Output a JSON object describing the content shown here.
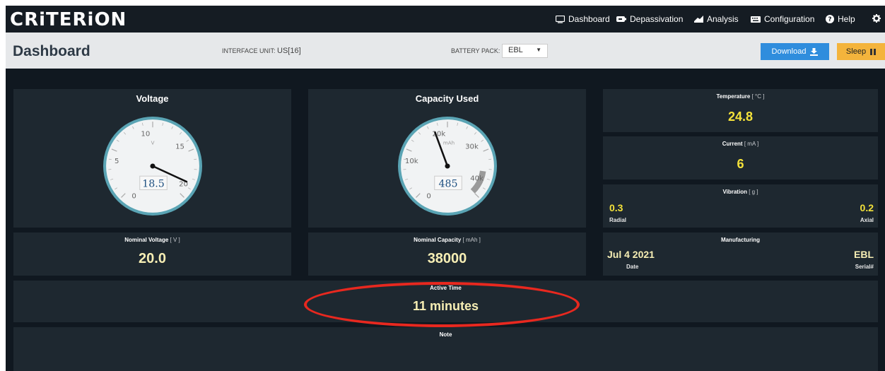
{
  "app": {
    "logo": "CRiTERiON"
  },
  "nav": [
    {
      "label": "Dashboard",
      "icon": "monitor-icon"
    },
    {
      "label": "Depassivation",
      "icon": "battery-icon"
    },
    {
      "label": "Analysis",
      "icon": "chart-icon"
    },
    {
      "label": "Configuration",
      "icon": "keyboard-icon"
    },
    {
      "label": "Help",
      "icon": "question-circle-icon"
    },
    {
      "icon": "gear-icon"
    }
  ],
  "header": {
    "title": "Dashboard",
    "interface_label": "INTERFACE UNIT:",
    "interface_value": "US[16]",
    "battery_pack_label": "BATTERY PACK:",
    "battery_pack_value": "EBL",
    "download_label": "Download",
    "sleep_label": "Sleep"
  },
  "voltage": {
    "title": "Voltage",
    "unit": "V",
    "ticks": [
      "0",
      "5",
      "10",
      "15",
      "20"
    ],
    "max": 20,
    "value": 18.5,
    "display": "18.5"
  },
  "capacity": {
    "title": "Capacity Used",
    "unit": "mAh",
    "ticks": [
      "0",
      "10k",
      "20k",
      "30k",
      "40k"
    ],
    "max": 40000,
    "value": 485,
    "display": "485",
    "needle_value": 17000
  },
  "nominal_voltage": {
    "label": "Nominal Voltage",
    "unit": "[ V ]",
    "value": "20.0"
  },
  "nominal_capacity": {
    "label": "Nominal Capacity",
    "unit": "[ mAh ]",
    "value": "38000"
  },
  "temperature": {
    "label": "Temperature",
    "unit": "[ °C ]",
    "value": "24.8"
  },
  "current": {
    "label": "Current",
    "unit": "[ mA ]",
    "value": "6"
  },
  "vibration": {
    "label": "Vibration",
    "unit": "[ g ]",
    "radial_value": "0.3",
    "radial_label": "Radial",
    "axial_value": "0.2",
    "axial_label": "Axial"
  },
  "manufacturing": {
    "label": "Manufacturing",
    "date_value": "Jul 4 2021",
    "date_label": "Date",
    "serial_value": "EBL",
    "serial_label": "Serial#"
  },
  "active_time": {
    "label": "Active Time",
    "value": "11 minutes"
  },
  "note": {
    "label": "Note"
  },
  "colors": {
    "accent_yellow": "#f4e23a",
    "download_blue": "#2f8ddd",
    "sleep_orange": "#f4b43c",
    "highlight_red": "#e8281f"
  }
}
